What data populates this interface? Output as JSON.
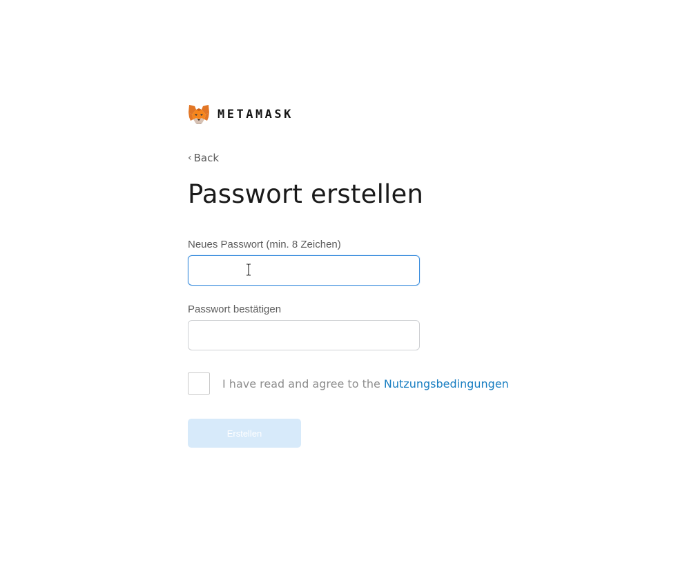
{
  "brand": {
    "logo_icon": "metamask-fox-icon",
    "wordmark": "METAMASK"
  },
  "nav": {
    "back_label": "Back",
    "back_icon": "chevron-left-icon"
  },
  "page_title": "Passwort erstellen",
  "form": {
    "new_password": {
      "label": "Neues Passwort (min. 8 Zeichen)",
      "value": "",
      "focused": true
    },
    "confirm_password": {
      "label": "Passwort bestätigen",
      "value": ""
    },
    "agree": {
      "checked": false,
      "text": "I have read and agree to the",
      "link_text": "Nutzungsbedingungen"
    },
    "submit": {
      "label": "Erstellen",
      "enabled": false
    }
  },
  "colors": {
    "link": "#1a7fc2",
    "focus_border": "#3a8ddd",
    "disabled_button": "#d7eafa",
    "fox_orange": "#e2761b"
  }
}
